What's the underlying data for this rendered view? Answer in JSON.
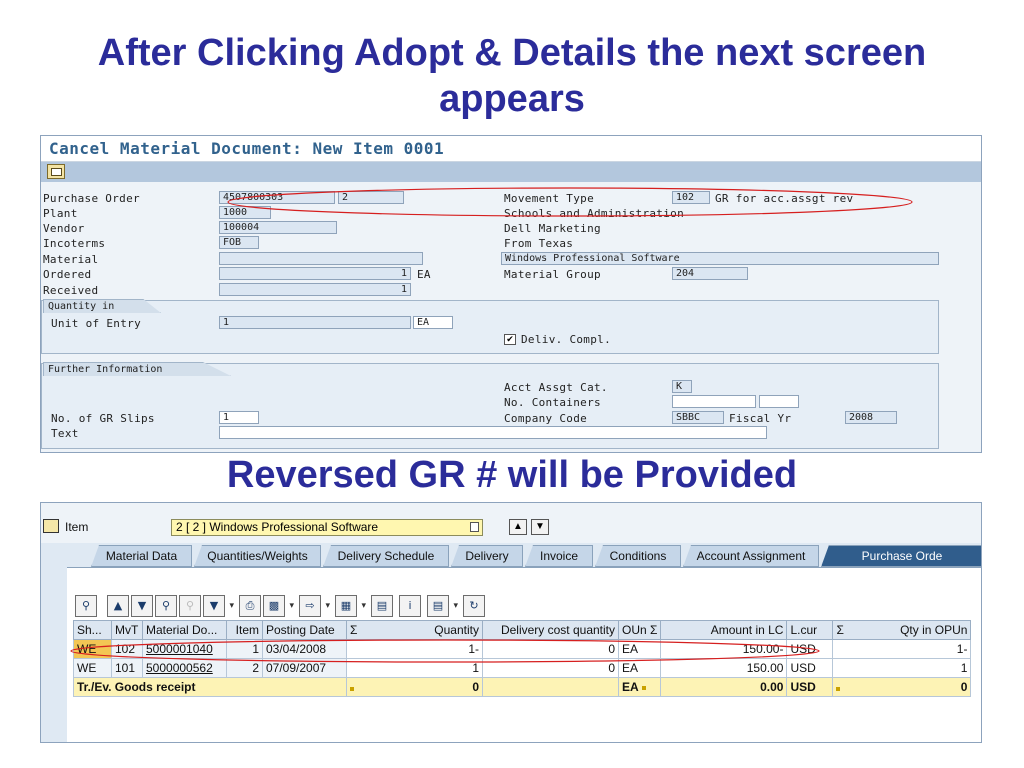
{
  "slide": {
    "title": "After Clicking Adopt & Details the next screen appears",
    "subtitle": "Reversed GR # will be Provided"
  },
  "screen1": {
    "title": "Cancel Material Document: New Item 0001",
    "toolbar_icon": "details-icon",
    "fields": {
      "purchase_order_label": "Purchase Order",
      "purchase_order_value": "4507800303",
      "purchase_order_item": "2",
      "plant_label": "Plant",
      "plant_value": "1000",
      "vendor_label": "Vendor",
      "vendor_value": "100004",
      "incoterms_label": "Incoterms",
      "incoterms_value": "FOB",
      "material_label": "Material",
      "material_value": "",
      "ordered_label": "Ordered",
      "ordered_value": "1",
      "ordered_unit": "EA",
      "received_label": "Received",
      "received_value": "1",
      "movement_type_label": "Movement Type",
      "movement_type_value": "102",
      "movement_type_text": "GR for acc.assgt rev",
      "plant_text": "Schools and Administration",
      "vendor_text": "Dell Marketing",
      "incoterms_text": "From Texas",
      "material_text": "Windows Professional Software",
      "material_group_label": "Material Group",
      "material_group_value": "204"
    },
    "quantity_in": {
      "group_label": "Quantity in",
      "unit_of_entry_label": "Unit of Entry",
      "unit_of_entry_value": "1",
      "unit_of_entry_unit": "EA",
      "deliv_compl_label": "Deliv. Compl.",
      "deliv_compl_checked": "✔"
    },
    "further_info": {
      "group_label": "Further Information",
      "acct_assgt_cat_label": "Acct Assgt Cat.",
      "acct_assgt_cat_value": "K",
      "no_containers_label": "No. Containers",
      "no_containers_value": "",
      "company_code_label": "Company Code",
      "company_code_value": "SBBC",
      "fiscal_yr_label": "Fiscal Yr",
      "fiscal_yr_value": "2008",
      "gr_slips_label": "No. of GR Slips",
      "gr_slips_value": "1",
      "text_label": "Text",
      "text_value": ""
    }
  },
  "screen2": {
    "item_label": "Item",
    "item_value": "2 [ 2 ] Windows Professional Software",
    "tabs": [
      {
        "label": "Material Data"
      },
      {
        "label": "Quantities/Weights"
      },
      {
        "label": "Delivery Schedule"
      },
      {
        "label": "Delivery"
      },
      {
        "label": "Invoice"
      },
      {
        "label": "Conditions"
      },
      {
        "label": "Account Assignment"
      },
      {
        "label": "Purchase Orde"
      }
    ],
    "columns": {
      "sh": "Sh...",
      "mvt": "MvT",
      "material_doc": "Material Do...",
      "item": "Item",
      "posting_date": "Posting Date",
      "sigma1": "Σ",
      "quantity": "Quantity",
      "delivery_cost_quantity": "Delivery cost quantity",
      "oun": "OUn",
      "sigma2": "Σ",
      "amount_in_lc": "Amount in LC",
      "lcur": "L.cur",
      "sigma3": "Σ",
      "qty_in_opun": "Qty in OPUn"
    },
    "rows": [
      {
        "sh": "WE",
        "mvt": "102",
        "material_doc": "5000001040",
        "item": "1",
        "posting_date": "03/04/2008",
        "quantity": "1-",
        "delivery_cost_quantity": "0",
        "oun": "EA",
        "amount_in_lc": "150.00-",
        "lcur": "USD",
        "qty_in_opun": "1-"
      },
      {
        "sh": "WE",
        "mvt": "101",
        "material_doc": "5000000562",
        "item": "2",
        "posting_date": "07/09/2007",
        "quantity": "1",
        "delivery_cost_quantity": "0",
        "oun": "EA",
        "amount_in_lc": "150.00",
        "lcur": "USD",
        "qty_in_opun": "1"
      }
    ],
    "summary": {
      "label": "Tr./Ev. Goods receipt",
      "quantity": "0",
      "oun": "EA",
      "amount_in_lc": "0.00",
      "lcur": "USD",
      "qty_in_opun": "0"
    }
  },
  "colors": {
    "title_blue": "#2b2c9a",
    "annotation_red": "#d61f1f",
    "sap_header_blue": "#31628d",
    "active_tab": "#305d8c",
    "selected_cell": "#f3c654"
  }
}
